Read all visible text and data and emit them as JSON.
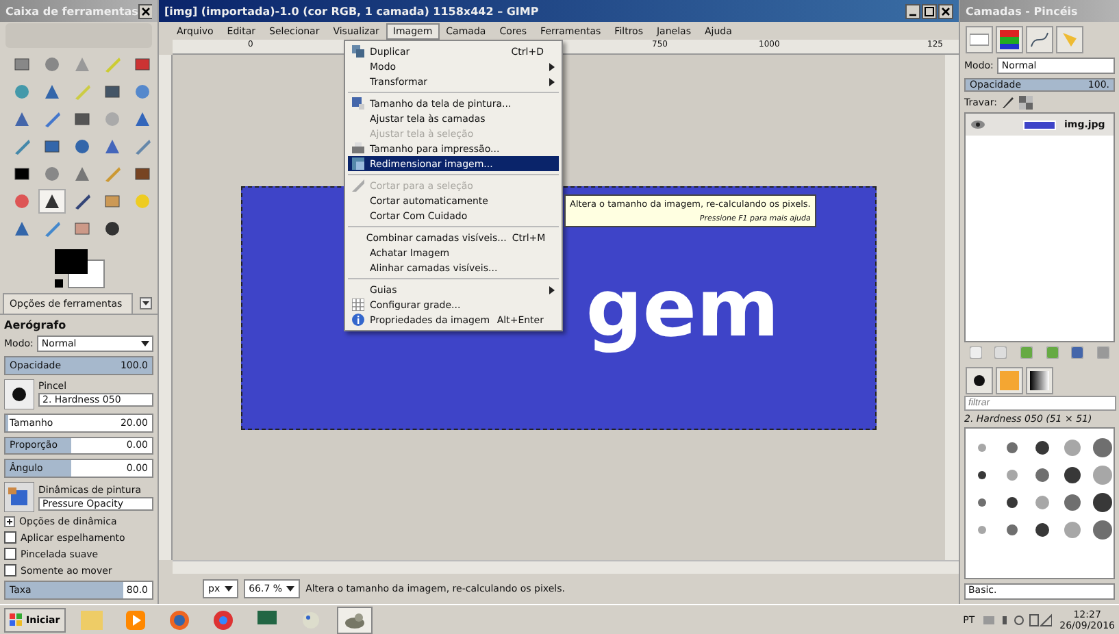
{
  "toolbox": {
    "title": "Caixa de ferramentas",
    "tools": [
      {
        "selected": false
      },
      {
        "selected": false
      },
      {
        "selected": false
      },
      {
        "selected": false
      },
      {
        "selected": false
      },
      {
        "selected": false
      },
      {
        "selected": false
      },
      {
        "selected": false
      },
      {
        "selected": false
      },
      {
        "selected": false
      },
      {
        "selected": false
      },
      {
        "selected": false
      },
      {
        "selected": false
      },
      {
        "selected": false
      },
      {
        "selected": false
      },
      {
        "selected": false
      },
      {
        "selected": false
      },
      {
        "selected": false
      },
      {
        "selected": false
      },
      {
        "selected": false
      },
      {
        "selected": false
      },
      {
        "selected": false
      },
      {
        "selected": false
      },
      {
        "selected": false
      },
      {
        "selected": false
      },
      {
        "selected": false
      },
      {
        "selected": true
      },
      {
        "selected": false
      },
      {
        "selected": false
      },
      {
        "selected": false
      },
      {
        "selected": false
      },
      {
        "selected": false
      },
      {
        "selected": false
      },
      {
        "selected": false
      }
    ],
    "options_tab": "Opções de ferramentas",
    "tool_name": "Aerógrafo",
    "mode_label": "Modo:",
    "mode": "Normal",
    "opacity": {
      "label": "Opacidade",
      "value": "100.0",
      "level": 1
    },
    "brush_label": "Pincel",
    "brush": "2. Hardness 050",
    "sliders": [
      {
        "label": "Tamanho",
        "value": "20.00",
        "level": 0.02
      },
      {
        "label": "Proporção",
        "value": "0.00",
        "level": 0.45
      },
      {
        "label": "Ângulo",
        "value": "0.00",
        "level": 0.45
      }
    ],
    "dynamics_label": "Dinâmicas de pintura",
    "dynamics": "Pressure Opacity",
    "dynamics_options": {
      "label": "Opções de dinâmica",
      "expanded": false
    },
    "checks": [
      {
        "label": "Aplicar espelhamento",
        "checked": false
      },
      {
        "label": "Pincelada suave",
        "checked": false
      },
      {
        "label": "Somente ao mover",
        "checked": false
      }
    ],
    "rate": {
      "label": "Taxa",
      "value": "80.0",
      "level": 0.8
    }
  },
  "window": {
    "title": "[img] (importada)-1.0 (cor RGB, 1 camada) 1158x442 – GIMP",
    "menubar": [
      {
        "label": "Arquivo",
        "selected": false
      },
      {
        "label": "Editar",
        "selected": false
      },
      {
        "label": "Selecionar",
        "selected": false
      },
      {
        "label": "Visualizar",
        "selected": false
      },
      {
        "label": "Imagem",
        "selected": true
      },
      {
        "label": "Camada",
        "selected": false
      },
      {
        "label": "Cores",
        "selected": false
      },
      {
        "label": "Ferramentas",
        "selected": false
      },
      {
        "label": "Filtros",
        "selected": false
      },
      {
        "label": "Janelas",
        "selected": false
      },
      {
        "label": "Ajuda",
        "selected": false
      }
    ],
    "ruler": [
      "0",
      "750",
      "1000",
      "125"
    ],
    "canvas_text": "gem",
    "menu": [
      [
        {
          "label": "Duplicar",
          "shortcut": "Ctrl+D",
          "kind": "duplicate",
          "submenu": false,
          "disabled": false,
          "selected": false
        },
        {
          "label": "Modo",
          "kind": "plain",
          "submenu": true,
          "disabled": false,
          "selected": false
        },
        {
          "label": "Transformar",
          "kind": "plain",
          "submenu": true,
          "disabled": false,
          "selected": false
        }
      ],
      [
        {
          "label": "Tamanho da tela de pintura...",
          "kind": "canvas",
          "submenu": false,
          "disabled": false,
          "selected": false
        },
        {
          "label": "Ajustar tela às camadas",
          "kind": "plain",
          "submenu": false,
          "disabled": false,
          "selected": false
        },
        {
          "label": "Ajustar tela à seleção",
          "kind": "plain",
          "submenu": false,
          "disabled": true,
          "selected": false
        },
        {
          "label": "Tamanho para impressão...",
          "kind": "print",
          "submenu": false,
          "disabled": false,
          "selected": false
        },
        {
          "label": "Redimensionar imagem...",
          "kind": "scale",
          "submenu": false,
          "disabled": false,
          "selected": true
        }
      ],
      [
        {
          "label": "Cortar para a seleção",
          "kind": "crop",
          "submenu": false,
          "disabled": true,
          "selected": false
        },
        {
          "label": "Cortar automaticamente",
          "kind": "plain",
          "submenu": false,
          "disabled": false,
          "selected": false
        },
        {
          "label": "Cortar Com Cuidado",
          "kind": "plain",
          "submenu": false,
          "disabled": false,
          "selected": false
        }
      ],
      [
        {
          "label": "Combinar camadas visíveis...",
          "shortcut": "Ctrl+M",
          "kind": "plain",
          "submenu": false,
          "disabled": false,
          "selected": false
        },
        {
          "label": "Achatar Imagem",
          "kind": "plain",
          "submenu": false,
          "disabled": false,
          "selected": false
        },
        {
          "label": "Alinhar camadas visíveis...",
          "kind": "plain",
          "submenu": false,
          "disabled": false,
          "selected": false
        }
      ],
      [
        {
          "label": "Guias",
          "kind": "plain",
          "submenu": true,
          "disabled": false,
          "selected": false
        },
        {
          "label": "Configurar grade...",
          "kind": "grid",
          "submenu": false,
          "disabled": false,
          "selected": false
        },
        {
          "label": "Propriedades da imagem",
          "shortcut": "Alt+Enter",
          "kind": "info",
          "submenu": false,
          "disabled": false,
          "selected": false
        }
      ]
    ],
    "tooltip": {
      "text": "Altera o tamanho da imagem, re-calculando os pixels.",
      "hint": "Pressione F1 para mais ajuda"
    },
    "status": {
      "unit": "px",
      "zoom": "66.7 %",
      "message": "Altera o tamanho da imagem, re-calculando os pixels."
    }
  },
  "dock": {
    "title": "Camadas - Pincéis",
    "mode_label": "Modo:",
    "mode": "Normal",
    "opacity": {
      "label": "Opacidade",
      "value": "100.",
      "level": 1
    },
    "lock_label": "Travar:",
    "layers": [
      {
        "name": "img.jpg",
        "visible": true
      }
    ],
    "brush_filter": {
      "placeholder": "filtrar"
    },
    "brush_name": "2. Hardness 050 (51 × 51)",
    "brush_tag": "Basic."
  },
  "taskbar": {
    "start": "Iniciar",
    "language": "PT",
    "time": "12:27",
    "date": "26/09/2016"
  }
}
